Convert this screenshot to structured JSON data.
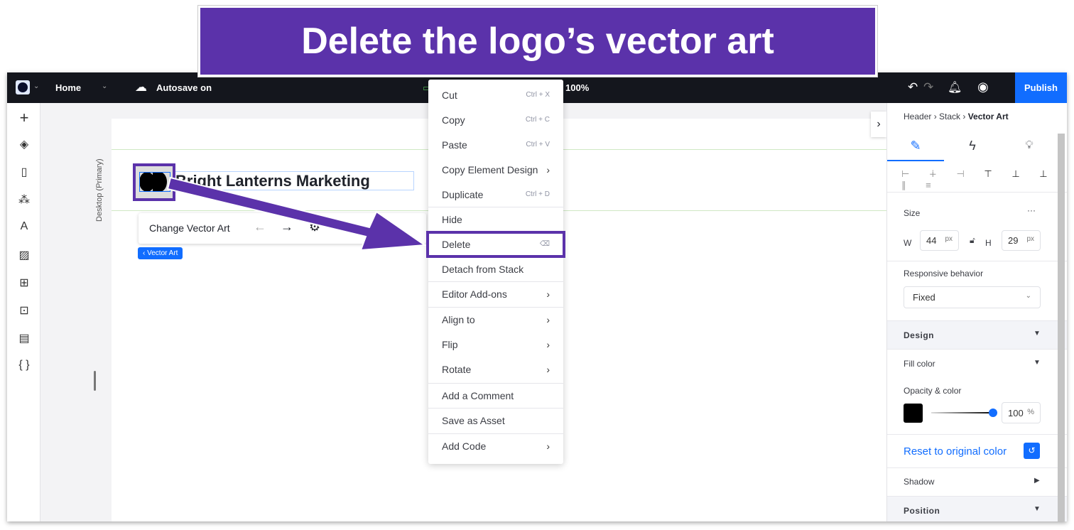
{
  "banner": {
    "title": "Delete the logo’s vector art"
  },
  "topbar": {
    "page": "Home",
    "autosave": "Autosave on",
    "zoom": "100%",
    "publish": "Publish"
  },
  "canvas": {
    "breakpoint": "Desktop (Primary)",
    "site_title": "Bright Lanterns Marketing",
    "toolbar_change": "Change Vector Art",
    "selection_tag": "‹ Vector Art"
  },
  "context_menu": {
    "items": [
      {
        "label": "Cut",
        "shortcut": "Ctrl + X"
      },
      {
        "label": "Copy",
        "shortcut": "Ctrl + C"
      },
      {
        "label": "Paste",
        "shortcut": "Ctrl + V"
      },
      {
        "label": "Copy Element Design",
        "shortcut": "›"
      },
      {
        "label": "Duplicate",
        "shortcut": "Ctrl + D"
      },
      {
        "label": "Hide",
        "shortcut": ""
      },
      {
        "label": "Delete",
        "shortcut": "⌫"
      },
      {
        "label": "Detach from Stack",
        "shortcut": ""
      },
      {
        "label": "Editor Add-ons",
        "shortcut": "›"
      },
      {
        "label": "Align to",
        "shortcut": "›"
      },
      {
        "label": "Flip",
        "shortcut": "›"
      },
      {
        "label": "Rotate",
        "shortcut": "›"
      },
      {
        "label": "Add a Comment",
        "shortcut": ""
      },
      {
        "label": "Save as Asset",
        "shortcut": ""
      },
      {
        "label": "Add Code",
        "shortcut": "›"
      }
    ]
  },
  "panel": {
    "breadcrumb": [
      "Header",
      "Stack",
      "Vector Art"
    ],
    "size_label": "Size",
    "more": "···",
    "w_label": "W",
    "w": "44",
    "h_label": "H",
    "h": "29",
    "unit": "px",
    "responsive_label": "Responsive behavior",
    "responsive_value": "Fixed",
    "design": "Design",
    "fill_color": "Fill color",
    "opacity_label": "Opacity & color",
    "opacity": "100",
    "pct": "%",
    "fill_hex": "#000000",
    "accent": "#116dff",
    "reset": "Reset to original color",
    "shadow": "Shadow",
    "position": "Position"
  }
}
